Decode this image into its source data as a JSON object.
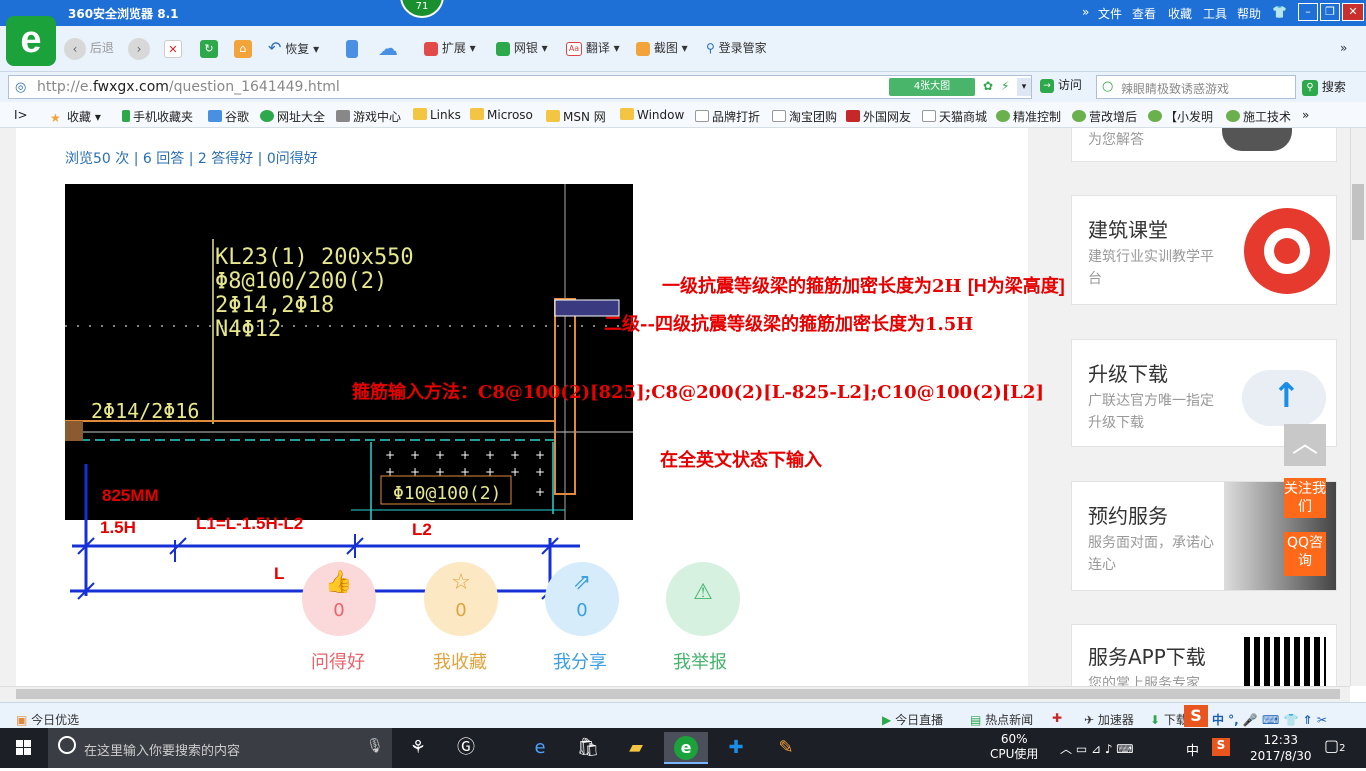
{
  "browser": {
    "title": "360安全浏览器 8.1",
    "notif_count": "71",
    "menu": [
      "文件",
      "查看",
      "收藏",
      "工具",
      "帮助"
    ],
    "back_label": "后退",
    "restore_label": "恢复",
    "toolbar_items": [
      "扩展",
      "网银",
      "翻译",
      "截图",
      "登录管家"
    ],
    "url_prefix": "http://e.",
    "url_domain": "fwxgx.com",
    "url_path": "/question_1641449.html",
    "big_image_label": "4张大图",
    "visit_label": "访问",
    "search_placeholder": "辣眼睛极致诱惑游戏",
    "search_button": "搜索",
    "favorites": [
      "收藏",
      "手机收藏夹",
      "谷歌",
      "网址大全",
      "游戏中心",
      "Links",
      "Microso",
      "MSN 网",
      "Window",
      "品牌打折",
      "淘宝团购",
      "外国网友",
      "天猫商城",
      "精准控制",
      "营改增后",
      "【小发明",
      "施工技术"
    ]
  },
  "page": {
    "stats": "浏览50 次 | 6 回答 | 2 答得好 | 0问得好",
    "cad": {
      "beam_label": [
        "KL23(1) 200x550",
        "Φ8@100/200(2)",
        "2Φ14,2Φ18",
        "N4Φ12"
      ],
      "bottom_bar": "2Φ14/2Φ16",
      "stirrup": "Φ10@100(2)"
    },
    "notes": {
      "line1": "一级抗震等级梁的箍筋加密长度为2H",
      "line1b": "[H为梁高度]",
      "line2": "二级--四级抗震等级梁的箍筋加密长度为1.5H",
      "line3": "箍筋输入方法：C8@100(2)[825];C8@200(2)[L-825-L2];C10@100(2)[L2]",
      "line4": "在全英文状态下输入"
    },
    "dims": {
      "mm": "825MM",
      "h15": "1.5H",
      "l1": "L1=L-1.5H-L2",
      "l2": "L2",
      "l": "L"
    },
    "actions": [
      {
        "count": "0",
        "label": "问得好",
        "color": "#e8636b",
        "bg": "#fbd8da",
        "icon": "thumbs-up"
      },
      {
        "count": "0",
        "label": "我收藏",
        "color": "#e0a33c",
        "bg": "#fde8c4",
        "icon": "star"
      },
      {
        "count": "0",
        "label": "我分享",
        "color": "#3c9ee0",
        "bg": "#d6ecfa",
        "icon": "share"
      },
      {
        "count": "0",
        "label": "我举报",
        "color": "#45b36b",
        "bg": "#d7f1e0",
        "icon": "warning"
      }
    ],
    "sidebar": {
      "top_sub": "为您解答",
      "cards": [
        {
          "title": "建筑课堂",
          "sub": "建筑行业实训教学平台"
        },
        {
          "title": "升级下载",
          "sub": "广联达官方唯一指定升级下载"
        },
        {
          "title": "预约服务",
          "sub": "服务面对面，承诺心连心"
        },
        {
          "title": "服务APP下载",
          "sub": "您的掌上服务专家"
        }
      ],
      "follow": "关注我们",
      "qq": "QQ咨询"
    }
  },
  "statusbar": {
    "left": "今日优选",
    "items": [
      "今日直播",
      "热点新闻",
      "加速器",
      "下载"
    ]
  },
  "taskbar": {
    "search_placeholder": "在这里输入你要搜索的内容",
    "cpu_pct": "60%",
    "cpu_label": "CPU使用",
    "ime": "中",
    "time": "12:33",
    "date": "2017/8/30",
    "notif": "2"
  }
}
